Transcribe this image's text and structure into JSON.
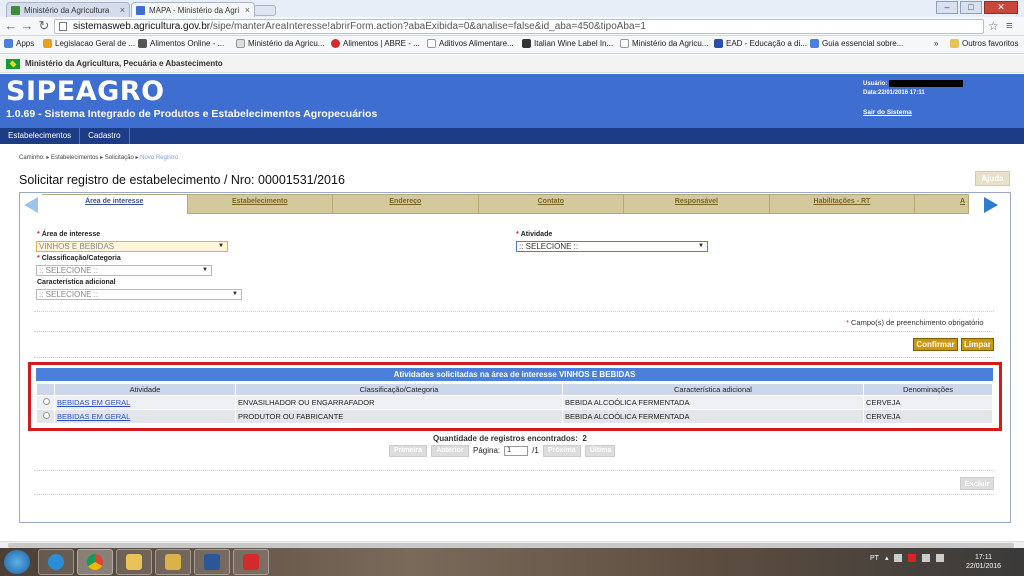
{
  "browser": {
    "tabs": [
      {
        "title": "Ministério da Agricultura"
      },
      {
        "title": "MAPA - Ministério da Agri"
      }
    ],
    "url_host": "sistemasweb.agricultura.gov.br",
    "url_path": "/sipe/manterAreaInteresse!abrirForm.action?abaExibida=0&analise=false&id_aba=450&tipoAba=1",
    "bookmarks": [
      {
        "label": "Apps",
        "color": "#4a7fdb"
      },
      {
        "label": "Legislacao Geral de ...",
        "color": "#e8a21a"
      },
      {
        "label": "Alimentos Online - ...",
        "color": "#555555"
      },
      {
        "label": "Ministério da Agricu...",
        "color": "#e8e8e8"
      },
      {
        "label": "Alimentos | ABRE - ...",
        "color": "#d22b2b"
      },
      {
        "label": "Aditivos Alimentare...",
        "color": "#e8e8e8"
      },
      {
        "label": "Italian Wine Label In...",
        "color": "#333333"
      },
      {
        "label": "Ministério da Agricu...",
        "color": "#3b8c3b"
      },
      {
        "label": "EAD - Educação a di...",
        "color": "#2b4fa8"
      },
      {
        "label": "Guia essencial sobre...",
        "color": "#4a7fdb"
      }
    ],
    "other_bookmarks": "Outros favoritos"
  },
  "gov_bar": "Ministério da Agricultura, Pecuária e Abastecimento",
  "header": {
    "title": "SIPEAGRO",
    "subtitle": "1.0.69 - Sistema Integrado de Produtos e Estabelecimentos Agropecuários",
    "user_label": "Usuário:",
    "date_line": "Data:22/01/2016 17:11",
    "logout": "Sair do Sistema"
  },
  "main_nav": [
    "Estabelecimentos",
    "Cadastro"
  ],
  "breadcrumb": {
    "items": [
      "Caminho:",
      "Estabelecimentos",
      "Solicitação"
    ],
    "current": "Novo Registro"
  },
  "page_title": "Solicitar registro de estabelecimento / Nro: 00001531/2016",
  "help_button": "Ajuda",
  "tabs": [
    "Área de interesse",
    "Estabelecimento",
    "Endereço",
    "Contato",
    "Responsável",
    "Habilitações - RT",
    "A"
  ],
  "form": {
    "area_label": "Área de interesse",
    "area_value": "VINHOS E BEBIDAS",
    "atividade_label": "Atividade",
    "atividade_value": ":: SELECIONE ::",
    "classificacao_label": "Classificação/Categoria",
    "classificacao_value": ":: SELECIONE ::",
    "caracteristica_label": "Característica adicional",
    "caracteristica_value": ":: SELECIONE ::",
    "required_note": "Campo(s) de preenchimento obrigatório",
    "confirm_button": "Confirmar",
    "clear_button": "Limpar"
  },
  "grid": {
    "title": "Atividades solicitadas na área de interesse VINHOS E BEBIDAS",
    "headers": [
      "Atividade",
      "Classificação/Categoria",
      "Característica adicional",
      "Denominações"
    ],
    "rows": [
      {
        "atividade": "BEBIDAS EM GERAL",
        "classificacao": "ENVASILHADOR OU ENGARRAFADOR",
        "caracteristica": "BEBIDA ALCOÓLICA FERMENTADA",
        "denominacao": "CERVEJA"
      },
      {
        "atividade": "BEBIDAS EM GERAL",
        "classificacao": "PRODUTOR OU FABRICANTE",
        "caracteristica": "BEBIDA ALCOÓLICA FERMENTADA",
        "denominacao": "CERVEJA"
      }
    ],
    "count_label": "Quantidade de registros encontrados:",
    "count": "2"
  },
  "pager": {
    "first": "Primeira",
    "prev": "Anterior",
    "page_label": "Página:",
    "page_value": "1",
    "total": "/1",
    "next": "Próxima",
    "last": "Última"
  },
  "delete_button": "Excluir",
  "taskbar": {
    "lang": "PT",
    "time": "17:11",
    "date": "22/01/2016"
  }
}
